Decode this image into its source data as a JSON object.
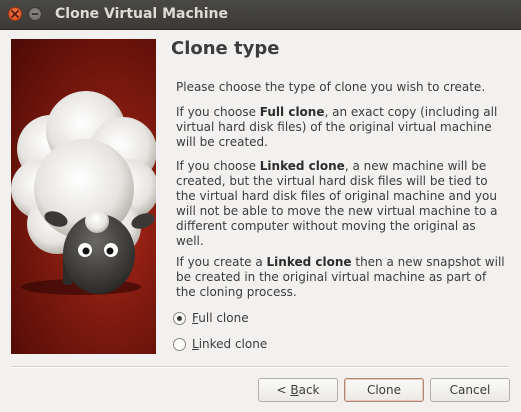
{
  "window": {
    "title": "Clone Virtual Machine"
  },
  "page": {
    "heading": "Clone type",
    "intro": "Please choose the type of clone you wish to create.",
    "full_clone_para": {
      "prefix": "If you choose ",
      "bold": "Full clone",
      "suffix": ", an exact copy (including all virtual hard disk files) of the original virtual machine will be created."
    },
    "linked_clone_para": {
      "prefix": "If you choose ",
      "bold": "Linked clone",
      "suffix": ", a new machine will be created, but the virtual hard disk files will be tied to the virtual hard disk files of original machine and you will not be able to move the new virtual machine to a different computer without moving the original as well."
    },
    "snapshot_para": {
      "prefix": "If you create a ",
      "bold": "Linked clone",
      "suffix": " then a new snapshot will be created in the original virtual machine as part of the cloning process."
    },
    "options": [
      {
        "mnemonic": "F",
        "rest": "ull clone",
        "checked": true
      },
      {
        "mnemonic": "L",
        "rest": "inked clone",
        "checked": false
      }
    ]
  },
  "buttons": {
    "back": {
      "prefix": "< ",
      "mnemonic": "B",
      "rest": "ack"
    },
    "clone": "Clone",
    "cancel": "Cancel"
  },
  "colors": {
    "titlebar": "#3b3a36",
    "close_button": "#e2562a",
    "art_background": "#8b1e12",
    "dialog_background": "#f2f1f0"
  },
  "icons": {
    "close": "close-icon",
    "minimize": "minimize-icon",
    "wizard_art": "sheep-watermark"
  }
}
